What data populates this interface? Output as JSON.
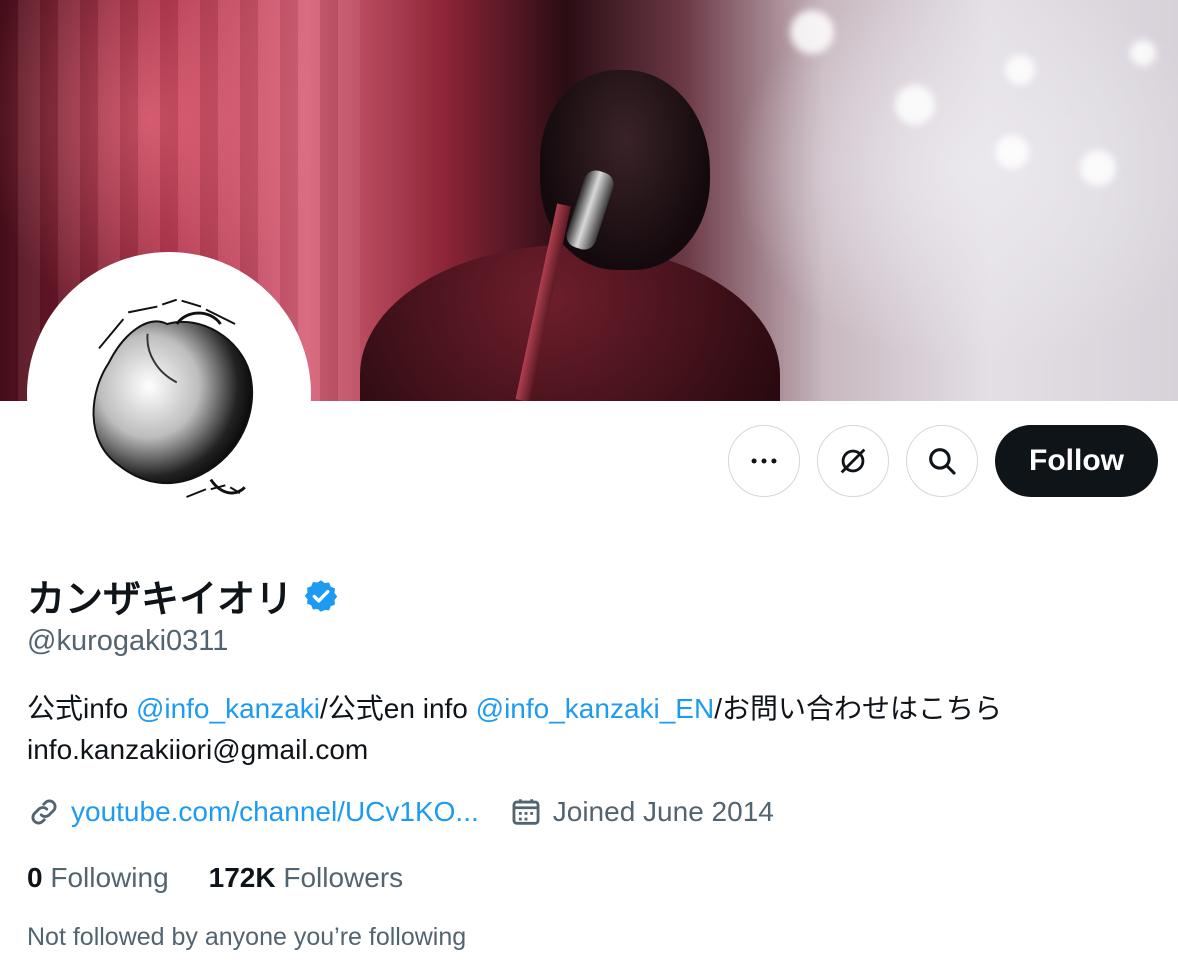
{
  "profile": {
    "display_name": "カンザキイオリ",
    "handle": "@kurogaki0311",
    "verified": true,
    "verified_icon": "verified-badge-icon",
    "accent_color": "#1d9bf0"
  },
  "actions": {
    "more_icon": "more-horizontal-icon",
    "grok_icon": "grok-icon",
    "search_icon": "search-icon",
    "follow_label": "Follow"
  },
  "bio": {
    "segments": [
      {
        "text": "公式info ",
        "type": "text"
      },
      {
        "text": "@info_kanzaki",
        "type": "mention"
      },
      {
        "text": "/公式en info ",
        "type": "text"
      },
      {
        "text": "@info_kanzaki_EN",
        "type": "mention"
      },
      {
        "text": "/お問い合わせはこちら info.kanzakiiori@gmail.com",
        "type": "text"
      }
    ]
  },
  "meta": {
    "link_icon": "link-icon",
    "link_text": "youtube.com/channel/UCv1KO...",
    "calendar_icon": "calendar-icon",
    "joined_text": "Joined June 2014"
  },
  "stats": {
    "following_count": "0",
    "following_label": "Following",
    "followers_count": "172K",
    "followers_label": "Followers"
  },
  "followed_by_text": "Not followed by anyone you’re following"
}
